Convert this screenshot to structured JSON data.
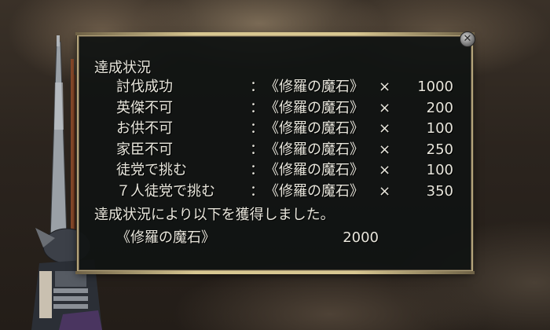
{
  "dialog": {
    "heading": "達成状況",
    "rows": [
      {
        "label": "討伐成功",
        "colon": "：",
        "item": "《修羅の魔石》",
        "times": "×",
        "qty": "1000"
      },
      {
        "label": "英傑不可",
        "colon": "：",
        "item": "《修羅の魔石》",
        "times": "×",
        "qty": "200"
      },
      {
        "label": "お供不可",
        "colon": "：",
        "item": "《修羅の魔石》",
        "times": "×",
        "qty": "100"
      },
      {
        "label": "家臣不可",
        "colon": "：",
        "item": "《修羅の魔石》",
        "times": "×",
        "qty": "250"
      },
      {
        "label": "徒党で挑む",
        "colon": "：",
        "item": "《修羅の魔石》",
        "times": "×",
        "qty": "100"
      },
      {
        "label": "７人徒党で挑む",
        "colon": "：",
        "item": "《修羅の魔石》",
        "times": "×",
        "qty": "350"
      }
    ],
    "result_message": "達成状況により以下を獲得しました。",
    "reward_item": "《修羅の魔石》",
    "reward_qty": "2000",
    "close_icon": "close-icon"
  },
  "colors": {
    "panel_bg": "#101312",
    "border_gold": "#b3a37a",
    "text": "#e8e6dc"
  }
}
